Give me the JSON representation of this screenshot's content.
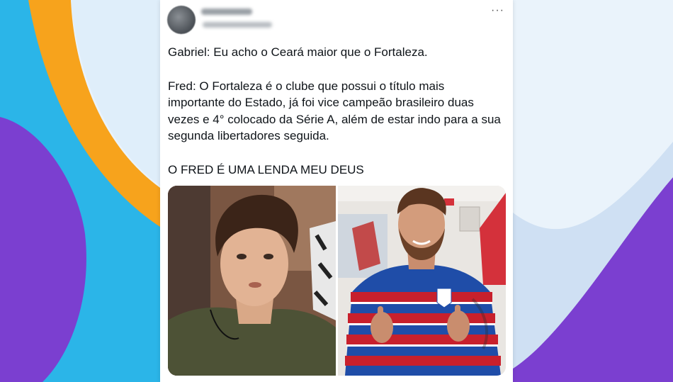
{
  "tweet": {
    "author_name": "",
    "author_handle": "",
    "more_icon": "more-horizontal-icon",
    "paragraphs": [
      "Gabriel: Eu acho o Ceará maior que o Fortaleza.",
      "Fred: O Fortaleza é o clube que possui o título mais importante do Estado, já foi vice campeão brasileiro duas vezes e 4° colocado da Série A, além de estar indo para a sua segunda libertadores seguida.",
      "O FRED É UMA LENDA MEU DEUS"
    ],
    "more_symbol": "···"
  },
  "colors": {
    "bg_light": "#eaf3fb",
    "bg_cyan": "#2bb5e8",
    "bg_orange": "#f7a31c",
    "bg_purple": "#7b3fd0",
    "jersey_red": "#c8202c",
    "jersey_blue": "#1f4da8"
  }
}
